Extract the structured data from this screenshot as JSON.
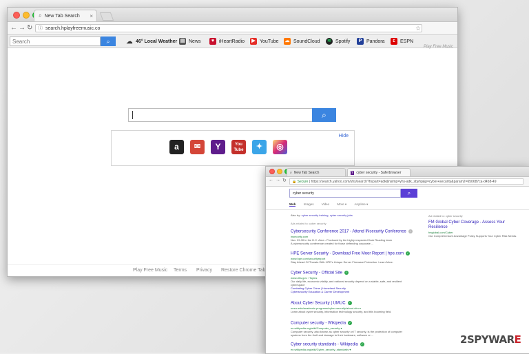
{
  "window1": {
    "tab_title": "New Tab Search",
    "url": "search.hplayfreemusic.co",
    "toolbar": {
      "search_placeholder": "Search",
      "links": [
        {
          "label": "46° Local Weather",
          "icon": "cloud-icon"
        },
        {
          "label": "News",
          "icon": "news-icon"
        },
        {
          "label": "iHeartRadio",
          "icon": "iheartradio-icon"
        },
        {
          "label": "YouTube",
          "icon": "youtube-icon"
        },
        {
          "label": "SoundCloud",
          "icon": "soundcloud-icon"
        },
        {
          "label": "Spotify",
          "icon": "spotify-icon"
        },
        {
          "label": "Pandora",
          "icon": "pandora-icon"
        },
        {
          "label": "ESPN",
          "icon": "espn-icon"
        }
      ]
    },
    "brand": "Play Free Music",
    "hide_label": "Hide",
    "tiles": [
      {
        "icon": "amazon-icon",
        "glyph": "a",
        "color": "#222222"
      },
      {
        "icon": "gmail-icon",
        "glyph": "✉",
        "color": "#d44638"
      },
      {
        "icon": "yahoo-icon",
        "glyph": "Y",
        "color": "#5f1d8c"
      },
      {
        "icon": "youtube-icon",
        "glyph": "You Tube",
        "color": "#c4302b"
      },
      {
        "icon": "twitter-icon",
        "glyph": "🐦",
        "color": "#3ba5e8"
      },
      {
        "icon": "instagram-icon",
        "glyph": "◎",
        "color": "#c13584"
      }
    ],
    "footer": [
      "Play Free Music",
      "Terms",
      "Privacy",
      "Restore Chrome Tab Pag"
    ]
  },
  "window2": {
    "tabs": [
      "New Tab Search",
      "cyber security - Saferbrowser"
    ],
    "url_secure": "Secure",
    "url_rest": "https://search.yahoo.com/yhs/search?hspart=adk&hsimp=yhs-adk_sbyhp&p=cyber+security&param2=650687ca-d458-49",
    "query": "cyber security",
    "tabs_row": [
      "Web",
      "Images",
      "Video",
      "More ▾",
      "Anytime ▾"
    ],
    "also_try_label": "Also try:",
    "also_try_links": "cyber security training, cyber security jobs",
    "ads_related": "Ads related to: cyber security",
    "results": [
      {
        "title": "Cybersecurity Conference 2017 - Attend INsecurity Conference",
        "url": "insecurity.com",
        "desc": [
          "Nov. 29-30 in the D.C. Area - Produced by the highly respected Dark Reading team",
          "A cybersecurity conference created for those defending corporate ..."
        ],
        "verified": false
      },
      {
        "title": "HPE Server Security - Download Free Moor Report | hpe.com",
        "url": "www.hpe.com/securityreport",
        "desc": [
          "Stay Ahead Of Threats With HPE's Unique Server Firmware Protection. Learn More."
        ],
        "verified": true
      },
      {
        "title": "Cyber Security - Official Site",
        "url": "www.dhs.gov › Topics",
        "desc": [
          "Our daily life, economic vitality, and national security depend on a stable, safe, and resilient",
          "cyberspace",
          "Combating Cyber Crime | Homeland Security",
          "Cybersecurity Education & Career Development"
        ],
        "verified": true
      },
      {
        "title": "About Cyber Security | UMUC",
        "url": "umuc.edu/academic-programs/cyber-security/about.cfm ▾",
        "desc": [
          "Learn about cyber security, information technology security, and this booming field."
        ],
        "verified": true
      },
      {
        "title": "Computer security - Wikipedia",
        "url": "en.wikipedia.org/wiki/Computer_security ▾",
        "desc": [
          "Computer security, also known as cyber security or IT security, is the protection of computer",
          "systems from the theft and damage to their hardware, software or ..."
        ],
        "verified": true
      },
      {
        "title": "Cyber security standards - Wikipedia",
        "url": "en.wikipedia.org/wiki/Cyber_security_standards ▾",
        "desc": [],
        "verified": true
      }
    ],
    "ad_side": {
      "label": "Ad related to: cyber security",
      "title": "FM Global Cyber Coverage - Assess Your Resilience",
      "url": "fmglobal.com/Cyber",
      "desc": "Our Comprehensive Advantage Policy Supports Your Cyber Risk Needs."
    }
  },
  "watermark": {
    "prefix": "2",
    "main": "SPYWAR",
    "accent": "E"
  }
}
